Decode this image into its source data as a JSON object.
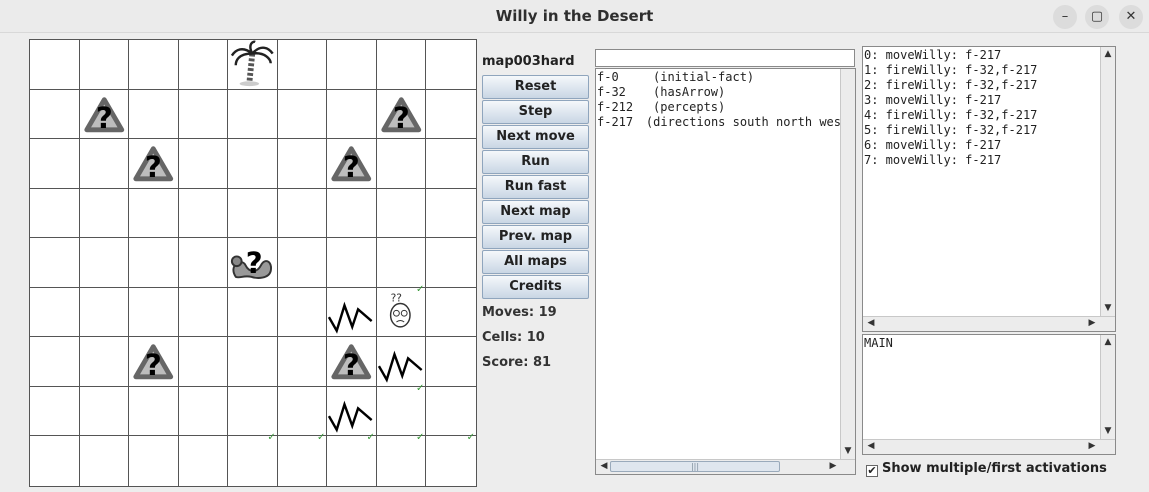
{
  "window": {
    "title": "Willy in the Desert",
    "controls": {
      "minimize": "–",
      "maximize": "▢",
      "close": "✕"
    }
  },
  "board": {
    "rows": 9,
    "cols": 9,
    "cells": [
      {
        "row": 0,
        "col": 4,
        "icon": "palm-tree"
      },
      {
        "row": 1,
        "col": 1,
        "icon": "hazard-question"
      },
      {
        "row": 1,
        "col": 7,
        "icon": "hazard-question"
      },
      {
        "row": 2,
        "col": 2,
        "icon": "hazard-question"
      },
      {
        "row": 2,
        "col": 6,
        "icon": "hazard-question"
      },
      {
        "row": 4,
        "col": 4,
        "icon": "snake-question"
      },
      {
        "row": 5,
        "col": 6,
        "icon": "zigzag"
      },
      {
        "row": 5,
        "col": 7,
        "icon": "willy",
        "check": true
      },
      {
        "row": 6,
        "col": 2,
        "icon": "hazard-question"
      },
      {
        "row": 6,
        "col": 6,
        "icon": "hazard-question"
      },
      {
        "row": 6,
        "col": 7,
        "icon": "zigzag"
      },
      {
        "row": 7,
        "col": 6,
        "icon": "zigzag"
      },
      {
        "row": 7,
        "col": 7,
        "check": true
      },
      {
        "row": 8,
        "col": 4,
        "check": true
      },
      {
        "row": 8,
        "col": 5,
        "check": true
      },
      {
        "row": 8,
        "col": 6,
        "check": true
      },
      {
        "row": 8,
        "col": 7,
        "check": true
      },
      {
        "row": 8,
        "col": 8,
        "check": true
      }
    ],
    "check_glyph": "✓"
  },
  "controls": {
    "map_name": "map003hard",
    "buttons": [
      {
        "key": "reset",
        "label": "Reset"
      },
      {
        "key": "step",
        "label": "Step"
      },
      {
        "key": "next-move",
        "label": "Next move"
      },
      {
        "key": "run",
        "label": "Run"
      },
      {
        "key": "run-fast",
        "label": "Run fast"
      },
      {
        "key": "next-map",
        "label": "Next map"
      },
      {
        "key": "prev-map",
        "label": "Prev. map"
      },
      {
        "key": "all-maps",
        "label": "All maps"
      },
      {
        "key": "credits",
        "label": "Credits"
      }
    ],
    "moves": "Moves: 19",
    "cells": "Cells: 10",
    "score": "Score: 81"
  },
  "facts": {
    "filter_value": "",
    "items": [
      {
        "id": "f-0",
        "text": "(initial-fact)"
      },
      {
        "id": "f-32",
        "text": "(hasArrow)"
      },
      {
        "id": "f-212",
        "text": "(percepts)"
      },
      {
        "id": "f-217",
        "text": "(directions south north wes"
      }
    ]
  },
  "agenda": {
    "items": [
      "0: moveWilly: f-217",
      "1: fireWilly: f-32,f-217",
      "2: fireWilly: f-32,f-217",
      "3: moveWilly: f-217",
      "4: fireWilly: f-32,f-217",
      "5: fireWilly: f-32,f-217",
      "6: moveWilly: f-217",
      "7: moveWilly: f-217"
    ]
  },
  "focus": {
    "items": [
      "MAIN"
    ]
  },
  "options": {
    "show_activations_label": "Show multiple/first activations",
    "show_activations_checked": true,
    "check_mark": "✔"
  },
  "scroll_glyphs": {
    "up": "▲",
    "down": "▼",
    "left": "◀",
    "right": "▶",
    "grip": "|||"
  }
}
